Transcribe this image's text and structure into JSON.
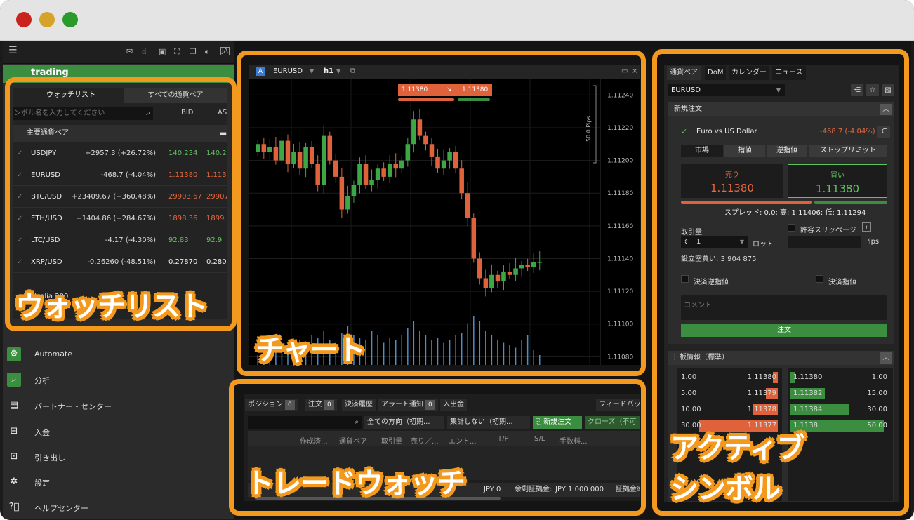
{
  "sidebar": {
    "brand_partial": "trading",
    "menu": [
      {
        "icon": "robot-icon",
        "label": "Automate"
      },
      {
        "icon": "analysis-icon",
        "label": "分析"
      },
      {
        "icon": "briefcase-icon",
        "label": "パートナー・センター"
      },
      {
        "icon": "deposit-icon",
        "label": "入金"
      },
      {
        "icon": "withdraw-icon",
        "label": "引き出し"
      },
      {
        "icon": "gear-icon",
        "label": "設定"
      },
      {
        "icon": "help-icon",
        "label": "ヘルプセンター"
      }
    ]
  },
  "watchlist": {
    "tab_watchlist": "ウォッチリスト",
    "tab_all_pairs": "すべての通貨ペア",
    "search_placeholder": "ンボル名を入力してください",
    "col_bid": "BID",
    "col_ask": "AS",
    "group": "主要通貨ペア",
    "rows": [
      {
        "symbol": "USDJPY",
        "change": "+2957.3 (+26.72%)",
        "bid": "140.234",
        "ask": "140.23",
        "tone": "green"
      },
      {
        "symbol": "EURUSD",
        "change": "-468.7 (-4.04%)",
        "bid": "1.11380",
        "ask": "1.1138",
        "tone": "red"
      },
      {
        "symbol": "BTC/USD",
        "change": "+23409.67 (+360.48%)",
        "bid": "29903.67",
        "ask": "29907.6",
        "tone": "red"
      },
      {
        "symbol": "ETH/USD",
        "change": "+1404.86 (+284.67%)",
        "bid": "1898.36",
        "ask": "1899.0",
        "tone": "red"
      },
      {
        "symbol": "LTC/USD",
        "change": "-4.17 (-4.30%)",
        "bid": "92.83",
        "ask": "92.9",
        "tone": "green"
      },
      {
        "symbol": "XRP/USD",
        "change": "-0.26260 (-48.51%)",
        "bid": "0.27870",
        "ask": "0.2801",
        "tone": "white"
      }
    ],
    "partial_row": "stralia 200"
  },
  "chart": {
    "symbol": "EURUSD",
    "timeframe": "h1",
    "sell_price": "1.11380",
    "buy_price": "1.11380",
    "pips_label": "50.0 Pips",
    "current_price": "1.11380",
    "price_ticks": [
      "1.11240",
      "1.11220",
      "1.11200",
      "1.11180",
      "1.11160",
      "1.11140",
      "1.11120",
      "1.11100",
      "1.11080"
    ],
    "candles": [
      [
        1.11205,
        1.1121
      ],
      [
        1.1121,
        1.11205
      ],
      [
        1.11205,
        1.11208
      ],
      [
        1.11208,
        1.112
      ],
      [
        1.112,
        1.11212
      ],
      [
        1.11212,
        1.11198
      ],
      [
        1.11198,
        1.11205
      ],
      [
        1.11205,
        1.11195
      ],
      [
        1.11195,
        1.11208
      ],
      [
        1.11208,
        1.11198
      ],
      [
        1.11198,
        1.11185
      ],
      [
        1.11185,
        1.11215
      ],
      [
        1.11215,
        1.112
      ],
      [
        1.112,
        1.1119
      ],
      [
        1.1119,
        1.1117
      ],
      [
        1.1117,
        1.11178
      ],
      [
        1.11178,
        1.11185
      ],
      [
        1.11185,
        1.11198
      ],
      [
        1.11198,
        1.11185
      ],
      [
        1.11185,
        1.11188
      ],
      [
        1.11188,
        1.11195
      ],
      [
        1.11195,
        1.1119
      ],
      [
        1.1119,
        1.11198
      ],
      [
        1.11198,
        1.11195
      ],
      [
        1.11195,
        1.112
      ],
      [
        1.112,
        1.1121
      ],
      [
        1.1121,
        1.11225
      ],
      [
        1.11225,
        1.11215
      ],
      [
        1.11215,
        1.1121
      ],
      [
        1.1121,
        1.11202
      ],
      [
        1.11202,
        1.11195
      ],
      [
        1.11195,
        1.112
      ],
      [
        1.112,
        1.11205
      ],
      [
        1.11205,
        1.11195
      ],
      [
        1.11195,
        1.1118
      ],
      [
        1.1118,
        1.11165
      ],
      [
        1.11165,
        1.1114
      ],
      [
        1.1114,
        1.11128
      ],
      [
        1.11128,
        1.11122
      ],
      [
        1.11122,
        1.1113
      ],
      [
        1.1113,
        1.11126
      ],
      [
        1.11126,
        1.11132
      ],
      [
        1.11132,
        1.1113
      ],
      [
        1.1113,
        1.11134
      ],
      [
        1.11134,
        1.11136
      ],
      [
        1.11136,
        1.11135
      ],
      [
        1.11135,
        1.11138
      ],
      [
        1.11138,
        1.11138
      ]
    ],
    "volumes": [
      0.2,
      0.3,
      0.25,
      0.4,
      0.35,
      0.3,
      0.45,
      0.5,
      0.4,
      0.6,
      0.55,
      0.7,
      0.5,
      0.45,
      0.65,
      0.8,
      0.6,
      0.55,
      0.5,
      0.7,
      0.6,
      0.45,
      0.55,
      0.5,
      0.6,
      0.75,
      0.9,
      0.7,
      0.6,
      0.5,
      0.55,
      0.45,
      0.5,
      0.6,
      0.65,
      0.85,
      1.0,
      0.9,
      0.7,
      0.6,
      0.5,
      0.45,
      0.4,
      0.35,
      0.5,
      0.6,
      0.3,
      0.2
    ]
  },
  "tradewatch": {
    "tabs": [
      {
        "label": "ポジション",
        "count": "0"
      },
      {
        "label": "注文",
        "count": "0"
      },
      {
        "label": "決済履歴",
        "count": ""
      },
      {
        "label": "アラート通知",
        "count": "0"
      },
      {
        "label": "入出金",
        "count": ""
      }
    ],
    "feed_tab": "フィードバッ",
    "filter_direction": "全ての方向（初期...",
    "filter_aggregate": "集計しない（初期...",
    "new_order": "新規注文",
    "close_btn": "クローズ（不可",
    "columns": [
      "作成済...",
      "通貨ペア",
      "取引量",
      "売り／...",
      "エント...",
      "T/P",
      "S/L",
      "手数料..."
    ],
    "footer_partial1": "00",
    "footer_partial2": "JPY 0",
    "free_margin_label": "余剰証拠金:",
    "free_margin_value": "JPY 1 000 000",
    "margin_partial": "証拠金率"
  },
  "active_symbol": {
    "tabs": [
      "通貨ペア",
      "DoM",
      "カレンダー",
      "ニュース"
    ],
    "symbol_select": "EURUSD",
    "new_order_title": "新規注文",
    "instrument": "Euro vs US Dollar",
    "change": "-468.7 (-4.04%)",
    "order_types": [
      "市場",
      "指値",
      "逆指値",
      "ストップリミット"
    ],
    "sell_label": "売り",
    "sell_price": "1.11380",
    "buy_label": "買い",
    "buy_price": "1.11380",
    "spread_info": "スプレッド: 0.0; 高: 1.11406; 低: 1.11294",
    "volume_label": "取引量",
    "volume_value": "1",
    "lot_unit": "ロット",
    "slippage_label": "許容スリッページ",
    "pips_unit": "Pips",
    "notional": "設立空買い: 3 904 875",
    "stop_loss_label": "決済逆指値",
    "take_profit_label": "決済指値",
    "comment_placeholder": "コメント",
    "submit": "注文",
    "dom_title": "板情報（標準）",
    "dom_sell": [
      {
        "vol": "1.00",
        "price": "1.11380",
        "fill": 0.05
      },
      {
        "vol": "5.00",
        "price": "1.11379",
        "fill": 0.12
      },
      {
        "vol": "10.00",
        "price": "1.11378",
        "fill": 0.25
      },
      {
        "vol": "30.00",
        "price": "1.11377",
        "fill": 0.8
      }
    ],
    "dom_buy": [
      {
        "price": "1.11380",
        "vol": "1.00",
        "fill": 0.05
      },
      {
        "price": "1.11382",
        "vol": "15.00",
        "fill": 0.35
      },
      {
        "price": "1.11384",
        "vol": "30.00",
        "fill": 0.6
      },
      {
        "price": "1.1138",
        "vol": "50.00",
        "fill": 0.95
      }
    ]
  },
  "annotations": {
    "watchlist": "ウォッチリスト",
    "chart": "チャート",
    "tradewatch": "トレードウォッチ",
    "active_symbol_line1": "アクティブ",
    "active_symbol_line2": "シンボル"
  },
  "colors": {
    "accent_orange": "#f39a1e",
    "green": "#3b8d3f",
    "red": "#e0623a"
  }
}
